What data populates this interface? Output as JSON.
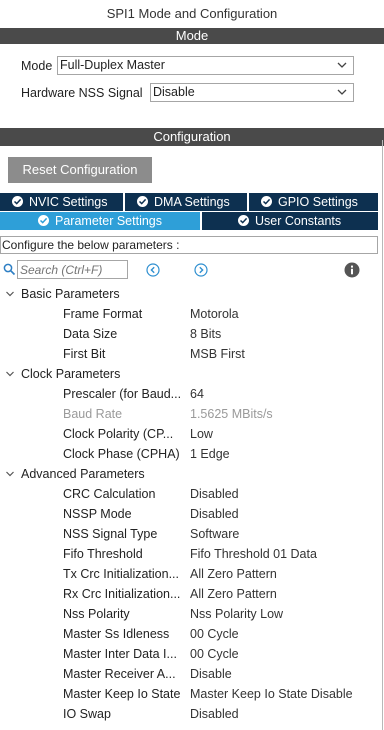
{
  "window": {
    "title": "SPI1 Mode and Configuration"
  },
  "mode_section": {
    "header": "Mode",
    "mode_label": "Mode",
    "mode_value": "Full-Duplex Master",
    "nss_label": "Hardware NSS Signal",
    "nss_value": "Disable"
  },
  "config_section": {
    "header": "Configuration",
    "reset_button": "Reset Configuration",
    "tabs_row1": [
      "NVIC Settings",
      "DMA Settings",
      "GPIO Settings"
    ],
    "tabs_row2": [
      "Parameter Settings",
      "User Constants"
    ],
    "active_tab": "Parameter Settings",
    "hint": "Configure the below parameters :",
    "search_placeholder": "Search (Ctrl+F)"
  },
  "colors": {
    "header_bar": "#4a4a4a",
    "tab_dark": "#0d3050",
    "tab_active": "#2e9fd8",
    "reset_button": "#8c8c8c"
  },
  "groups": [
    {
      "name": "Basic Parameters",
      "params": [
        {
          "name": "Frame Format",
          "value": "Motorola"
        },
        {
          "name": "Data Size",
          "value": "8 Bits"
        },
        {
          "name": "First Bit",
          "value": "MSB First"
        }
      ]
    },
    {
      "name": "Clock Parameters",
      "params": [
        {
          "name": "Prescaler (for Baud...",
          "value": "64"
        },
        {
          "name": "Baud Rate",
          "value": "1.5625 MBits/s",
          "disabled": true
        },
        {
          "name": "Clock Polarity (CP...",
          "value": "Low"
        },
        {
          "name": "Clock Phase (CPHA)",
          "value": "1 Edge"
        }
      ]
    },
    {
      "name": "Advanced Parameters",
      "params": [
        {
          "name": "CRC Calculation",
          "value": "Disabled"
        },
        {
          "name": "NSSP Mode",
          "value": "Disabled"
        },
        {
          "name": "NSS Signal Type",
          "value": "Software"
        },
        {
          "name": "Fifo Threshold",
          "value": "Fifo Threshold 01 Data"
        },
        {
          "name": "Tx Crc Initialization...",
          "value": "All Zero Pattern"
        },
        {
          "name": "Rx Crc Initialization...",
          "value": "All Zero Pattern"
        },
        {
          "name": "Nss Polarity",
          "value": "Nss Polarity Low"
        },
        {
          "name": "Master Ss Idleness",
          "value": "00 Cycle"
        },
        {
          "name": "Master Inter Data I...",
          "value": "00 Cycle"
        },
        {
          "name": "Master Receiver A...",
          "value": "Disable"
        },
        {
          "name": "Master Keep Io State",
          "value": "Master Keep Io State Disable"
        },
        {
          "name": "IO Swap",
          "value": "Disabled"
        }
      ]
    }
  ]
}
